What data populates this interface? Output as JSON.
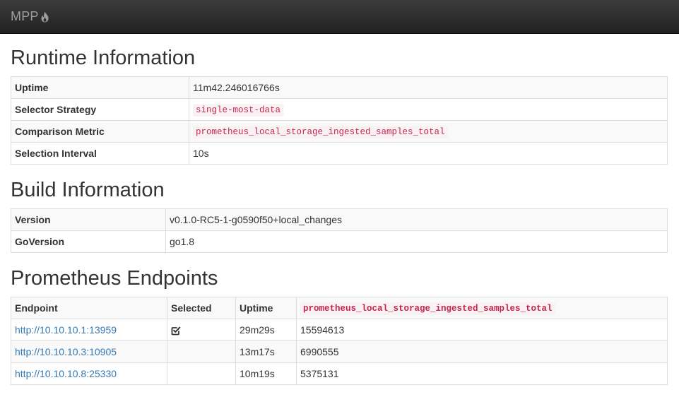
{
  "navbar": {
    "brand": "MPP",
    "brand_icon": "flame-icon"
  },
  "runtime": {
    "title": "Runtime Information",
    "rows": [
      {
        "label": "Uptime",
        "value": "11m42.246016766s",
        "code": false
      },
      {
        "label": "Selector Strategy",
        "value": "single-most-data",
        "code": true
      },
      {
        "label": "Comparison Metric",
        "value": "prometheus_local_storage_ingested_samples_total",
        "code": true
      },
      {
        "label": "Selection Interval",
        "value": "10s",
        "code": false
      }
    ]
  },
  "build": {
    "title": "Build Information",
    "rows": [
      {
        "label": "Version",
        "value": "v0.1.0-RC5-1-g0590f50+local_changes"
      },
      {
        "label": "GoVersion",
        "value": "go1.8"
      }
    ]
  },
  "endpoints": {
    "title": "Prometheus Endpoints",
    "headers": {
      "endpoint": "Endpoint",
      "selected": "Selected",
      "uptime": "Uptime",
      "metric": "prometheus_local_storage_ingested_samples_total"
    },
    "rows": [
      {
        "url": "http://10.10.10.1:13959",
        "selected": true,
        "uptime": "29m29s",
        "value": "15594613"
      },
      {
        "url": "http://10.10.10.3:10905",
        "selected": false,
        "uptime": "13m17s",
        "value": "6990555"
      },
      {
        "url": "http://10.10.10.8:25330",
        "selected": false,
        "uptime": "10m19s",
        "value": "5375131"
      }
    ],
    "selected_icon": "check-square-icon"
  },
  "colors": {
    "navbar": "#222222",
    "link": "#337ab7",
    "code_text": "#c7254e",
    "code_bg": "#f9f2f4",
    "stripe": "#f9f9f9"
  }
}
